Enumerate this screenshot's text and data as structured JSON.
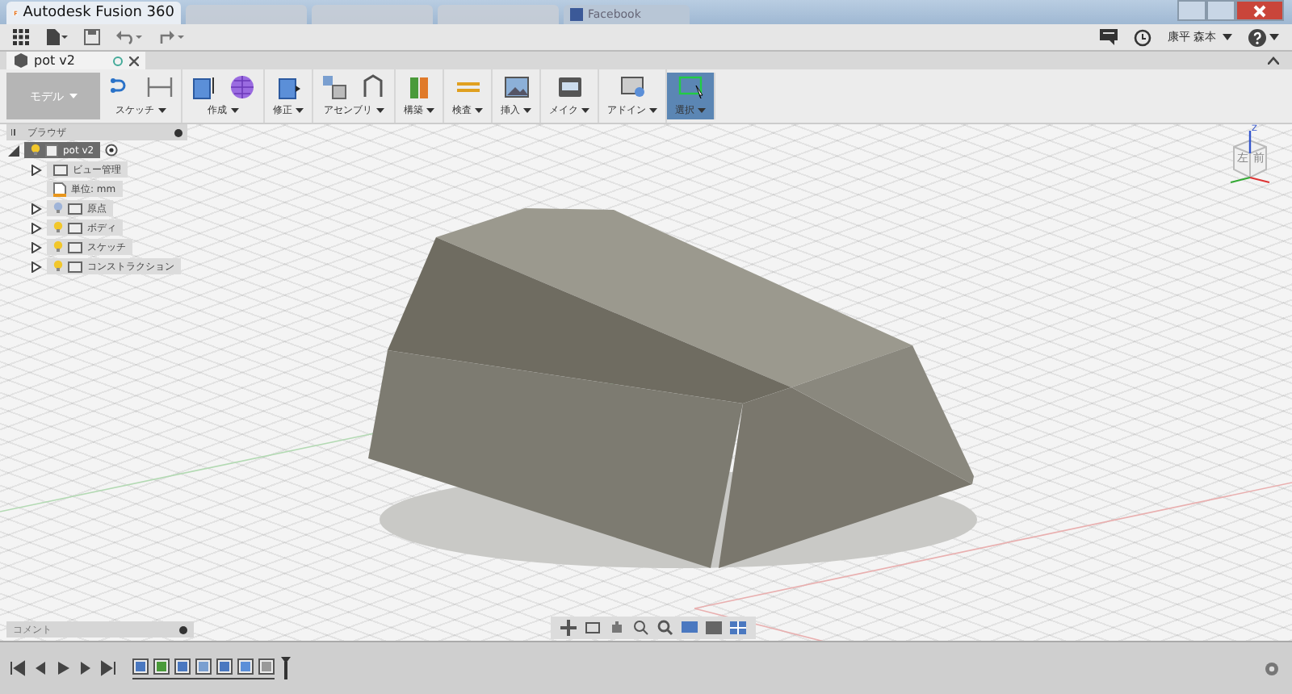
{
  "window": {
    "title": "Autodesk Fusion 360",
    "browser_tabs": [
      {
        "label": "Facebook"
      }
    ]
  },
  "quick_toolbar": {
    "user": "康平 森本"
  },
  "document_tab": {
    "label": "pot v2"
  },
  "ribbon": {
    "workspace": "モデル",
    "groups": [
      {
        "label": "スケッチ",
        "selected": false
      },
      {
        "label": "作成",
        "selected": false
      },
      {
        "label": "修正",
        "selected": false
      },
      {
        "label": "アセンブリ",
        "selected": false
      },
      {
        "label": "構築",
        "selected": false
      },
      {
        "label": "検査",
        "selected": false
      },
      {
        "label": "挿入",
        "selected": false
      },
      {
        "label": "メイク",
        "selected": false
      },
      {
        "label": "アドイン",
        "selected": false
      },
      {
        "label": "選択",
        "selected": true
      }
    ]
  },
  "browser": {
    "title": "ブラウザ",
    "tree": [
      {
        "label": "pot v2",
        "kind": "root",
        "expanded": true,
        "selected": true,
        "children": [
          {
            "label": "ビュー管理",
            "kind": "folder",
            "selected": false
          },
          {
            "label": "単位: mm",
            "kind": "units",
            "selected": false
          },
          {
            "label": "原点",
            "kind": "light-folder",
            "light_on": false,
            "selected": false
          },
          {
            "label": "ボディ",
            "kind": "light-folder",
            "light_on": true,
            "selected": false
          },
          {
            "label": "スケッチ",
            "kind": "light-folder",
            "light_on": true,
            "selected": false
          },
          {
            "label": "コンストラクション",
            "kind": "light-folder",
            "light_on": true,
            "selected": false
          }
        ]
      }
    ]
  },
  "view_cube": {
    "left_face": "左",
    "front_face": "前",
    "axis": "Z"
  },
  "comments": {
    "title": "コメント"
  }
}
